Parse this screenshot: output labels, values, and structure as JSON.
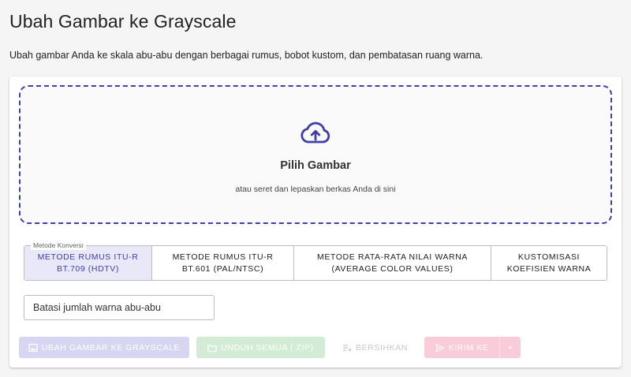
{
  "page": {
    "title": "Ubah Gambar ke Grayscale",
    "description": "Ubah gambar Anda ke skala abu-abu dengan berbagai rumus, bobot kustom, dan pembatasan ruang warna."
  },
  "dropzone": {
    "icon": "cloud-upload-icon",
    "title": "Pilih Gambar",
    "subtitle": "atau seret dan lepaskan berkas Anda di sini"
  },
  "method": {
    "legend": "Metode Konversi",
    "options": [
      {
        "label": "METODE RUMUS ITU-R BT.709 (HDTV)",
        "selected": true
      },
      {
        "label": "METODE RUMUS ITU-R BT.601 (PAL/NTSC)",
        "selected": false
      },
      {
        "label": "METODE RATA-RATA NILAI WARNA (AVERAGE COLOR VALUES)",
        "selected": false
      },
      {
        "label": "KUSTOMISASI KOEFISIEN WARNA",
        "selected": false
      }
    ]
  },
  "limit_input": {
    "placeholder": "Batasi jumlah warna abu-abu",
    "value": ""
  },
  "actions": {
    "convert_label": "UBAH GAMBAR KE GRAYSCALE",
    "download_label": "UNDUH SEMUA (.ZIP)",
    "clear_label": "BERSIHKAN",
    "send_label": "KIRIM KE"
  },
  "colors": {
    "accent": "#3f3fa8",
    "success_disabled": "#d3ecd6",
    "secondary_disabled": "#f8cdd9"
  }
}
